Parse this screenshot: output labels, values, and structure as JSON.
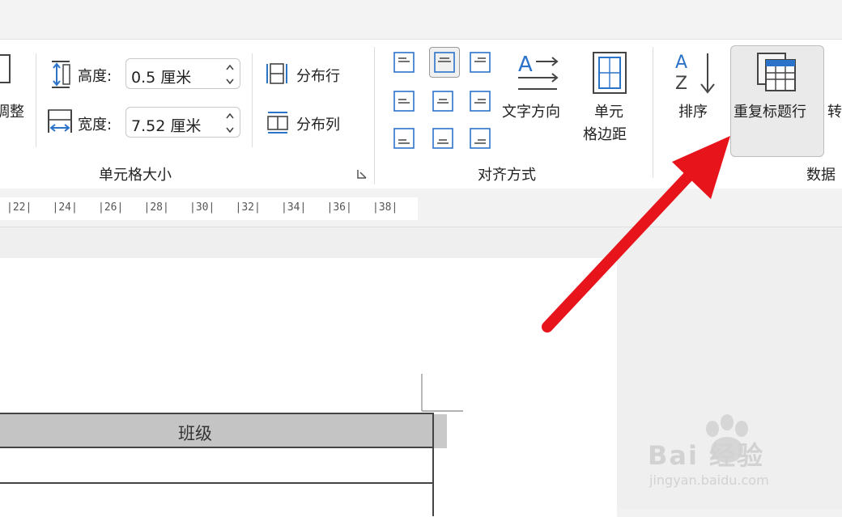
{
  "ribbon": {
    "left_partial": {
      "top_glyph": "…",
      "label": "调整"
    },
    "cell_size": {
      "height_label": "高度:",
      "height_value": "0.5 厘米",
      "width_label": "宽度:",
      "width_value": "7.52 厘米",
      "distribute_rows": "分布行",
      "distribute_cols": "分布列",
      "group_title": "单元格大小"
    },
    "alignment": {
      "text_direction": "文字方向",
      "cell_margin_line1": "单元",
      "cell_margin_line2": "格边距",
      "group_title": "对齐方式"
    },
    "data": {
      "sort": "排序",
      "repeat_header": "重复标题行",
      "convert_partial": "转",
      "group_title": "数据"
    }
  },
  "ruler": {
    "ticks": [
      "22",
      "24",
      "26",
      "28",
      "30",
      "32",
      "34",
      "36",
      "38"
    ]
  },
  "table": {
    "header_cell": "班级"
  },
  "watermark": {
    "brand": "Bai 经验",
    "url": "jingyan.baidu.com"
  },
  "colors": {
    "accent_blue": "#2b73c9",
    "arrow_red": "#e8141b",
    "header_gray": "#c4c4c4"
  }
}
